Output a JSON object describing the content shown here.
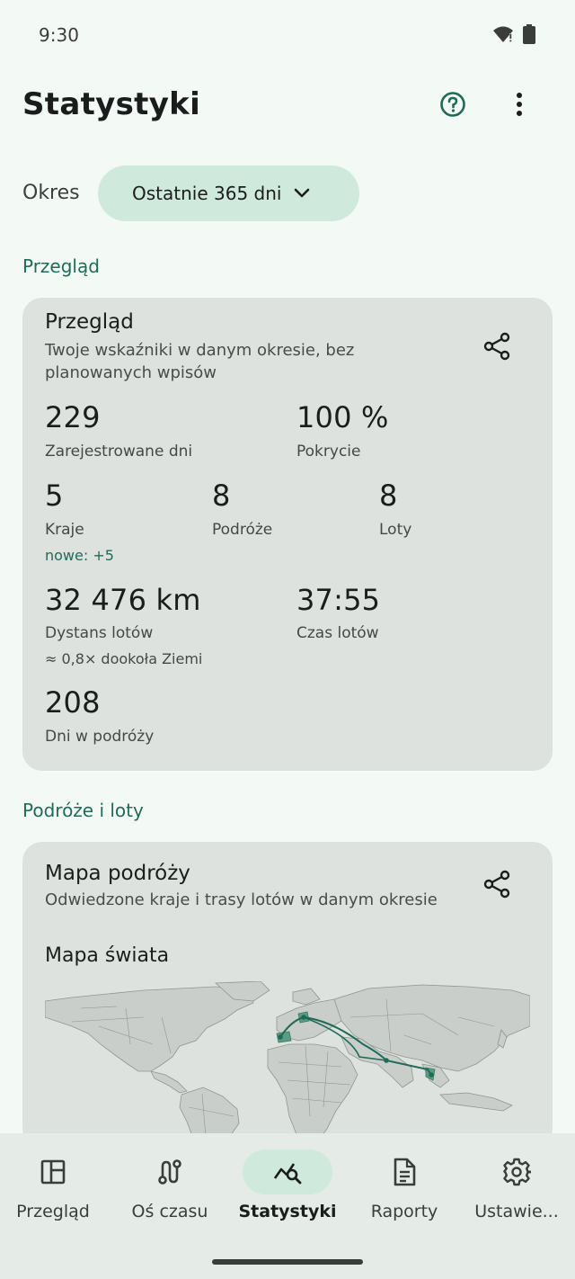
{
  "status_bar": {
    "time": "9:30"
  },
  "app_bar": {
    "title": "Statystyki",
    "help_icon": "help-circle-icon",
    "more_icon": "more-vert-icon"
  },
  "period": {
    "label": "Okres",
    "selected": "Ostatnie 365 dni"
  },
  "sections": {
    "overview_header": "Przegląd",
    "trips_header": "Podróże i loty"
  },
  "overview_card": {
    "title": "Przegląd",
    "subtitle": "Twoje wskaźniki w danym okresie, bez planowanych wpisów",
    "metrics": {
      "days": {
        "value": "229",
        "label": "Zarejestrowane dni"
      },
      "coverage": {
        "value": "100 %",
        "label": "Pokrycie"
      },
      "countries": {
        "value": "5",
        "label": "Kraje",
        "note": "nowe: +5"
      },
      "trips": {
        "value": "8",
        "label": "Podróże"
      },
      "flights": {
        "value": "8",
        "label": "Loty"
      },
      "distance": {
        "value": "32 476 km",
        "label": "Dystans lotów",
        "note": "≈ 0,8× dookoła Ziemi"
      },
      "flight_time": {
        "value": "37:55",
        "label": "Czas lotów"
      },
      "travel_days": {
        "value": "208",
        "label": "Dni w podróży"
      }
    }
  },
  "map_card": {
    "title": "Mapa podróży",
    "subtitle": "Odwiedzone kraje i trasy lotów w danym okresie",
    "map_heading": "Mapa świata"
  },
  "bottom_nav": {
    "items": [
      {
        "label": "Przegląd",
        "icon": "dashboard-icon"
      },
      {
        "label": "Oś czasu",
        "icon": "route-icon"
      },
      {
        "label": "Statystyki",
        "icon": "stats-icon",
        "active": true
      },
      {
        "label": "Raporty",
        "icon": "report-icon"
      },
      {
        "label": "Ustawie...",
        "icon": "settings-icon"
      }
    ]
  },
  "colors": {
    "accent": "#1f6b58",
    "chip": "#cfe9dd",
    "card": "#dde2df",
    "background": "#f3f9f5"
  }
}
